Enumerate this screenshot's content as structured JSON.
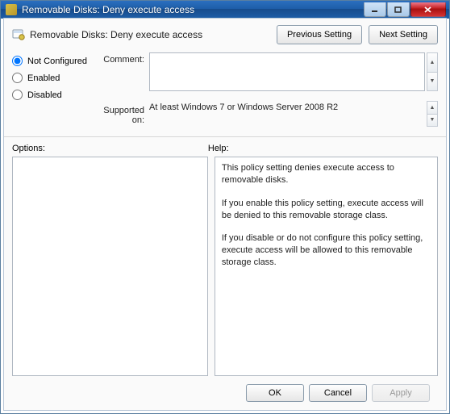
{
  "window": {
    "title": "Removable Disks: Deny execute access"
  },
  "header": {
    "title": "Removable Disks: Deny execute access",
    "prev_btn": "Previous Setting",
    "next_btn": "Next Setting"
  },
  "state": {
    "options": [
      {
        "key": "not_configured",
        "label": "Not Configured",
        "selected": true
      },
      {
        "key": "enabled",
        "label": "Enabled",
        "selected": false
      },
      {
        "key": "disabled",
        "label": "Disabled",
        "selected": false
      }
    ]
  },
  "labels": {
    "comment": "Comment:",
    "supported_on": "Supported on:",
    "options": "Options:",
    "help": "Help:"
  },
  "fields": {
    "comment_value": "",
    "supported_on_value": "At least Windows 7 or Windows Server 2008 R2"
  },
  "help_text": {
    "p1": "This policy setting denies execute access to removable disks.",
    "p2": "If you enable this policy setting, execute access will be denied to this removable storage class.",
    "p3": "If you disable or do not configure this policy setting, execute access will be allowed to this removable storage class."
  },
  "buttons": {
    "ok": "OK",
    "cancel": "Cancel",
    "apply": "Apply"
  }
}
